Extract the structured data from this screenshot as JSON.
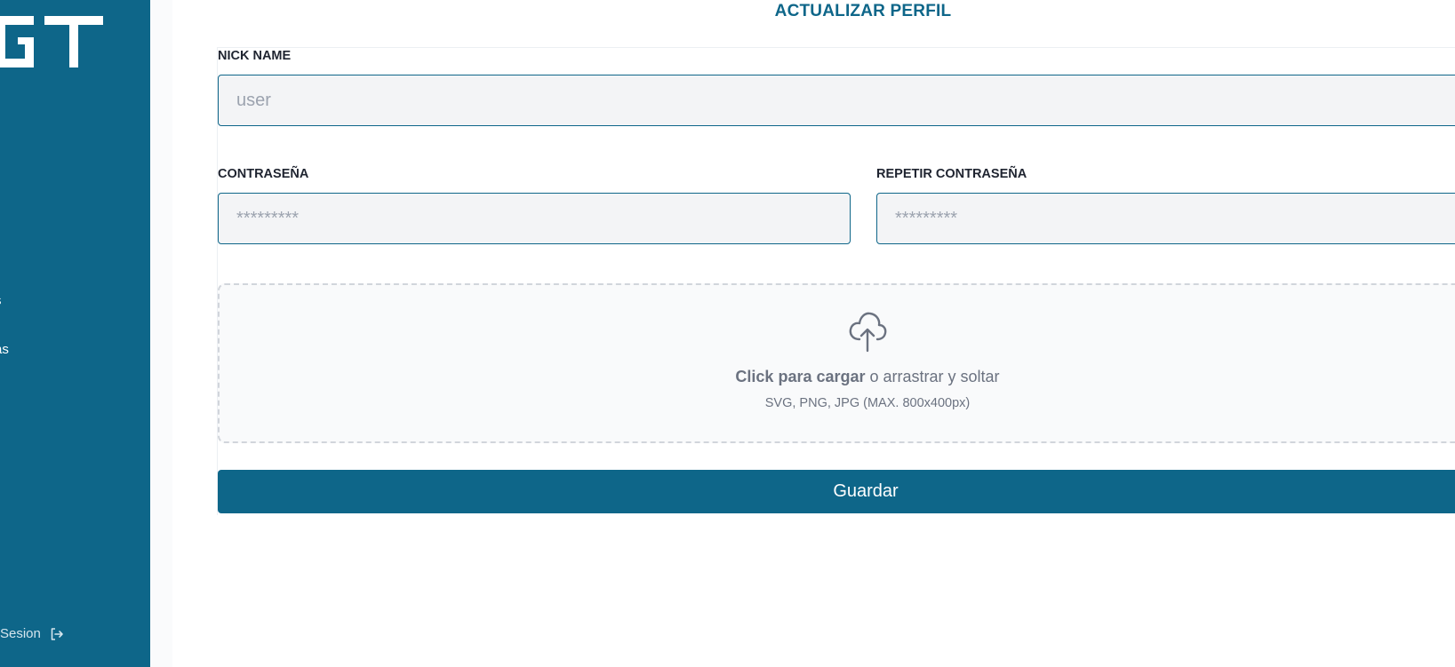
{
  "sidebar": {
    "logo_text": "GT",
    "items": [
      {
        "label": "s"
      },
      {
        "label": "as"
      }
    ],
    "logout_label": "Sesion",
    "logout_icon": "logout-icon"
  },
  "main": {
    "title": "ACTUALIZAR PERFIL",
    "nickname": {
      "label": "NICK NAME",
      "placeholder": "user",
      "value": ""
    },
    "password": {
      "label": "CONTRASEÑA",
      "placeholder": "*********",
      "value": ""
    },
    "repeat_password": {
      "label": "REPETIR CONTRASEÑA",
      "placeholder": "*********",
      "value": ""
    },
    "upload": {
      "icon": "cloud-upload-icon",
      "cta_bold": "Click para cargar",
      "cta_rest": " o arrastrar y soltar",
      "hint": "SVG, PNG, JPG (MAX. 800x400px)"
    },
    "save_label": "Guardar"
  },
  "colors": {
    "primary": "#0e6689",
    "field_bg": "#f3f4f6",
    "upload_bg": "#f9fafb",
    "muted_text": "#6b7280"
  }
}
